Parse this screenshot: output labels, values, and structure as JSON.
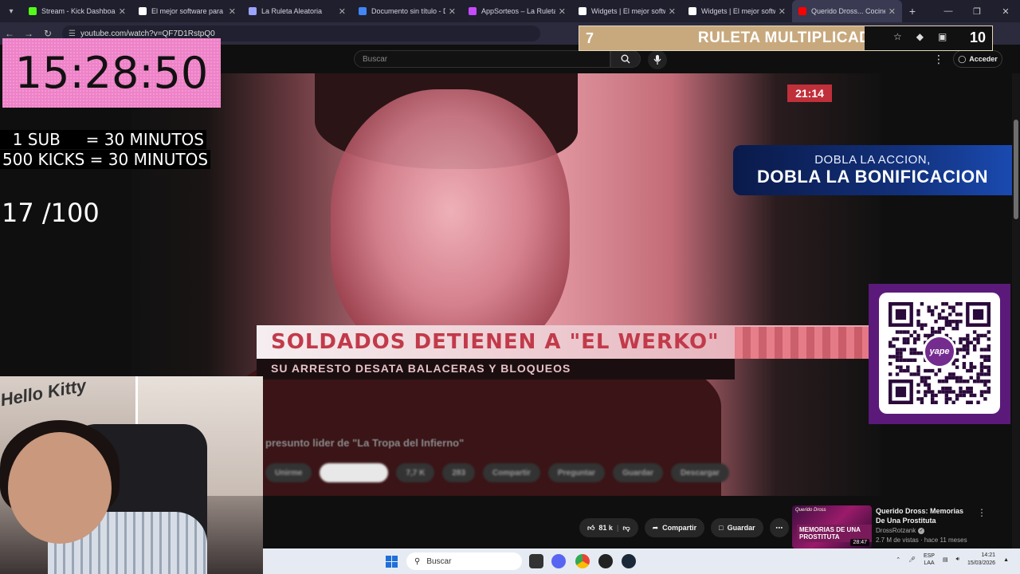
{
  "browser": {
    "tabs": [
      {
        "label": "Stream - Kick Dashboard",
        "color": "#53fc18"
      },
      {
        "label": "El mejor software para pu",
        "color": "#ffffff"
      },
      {
        "label": "La Ruleta Aleatoria",
        "color": "#9aa4ff"
      },
      {
        "label": "Documento sin título - Do",
        "color": "#4285f4"
      },
      {
        "label": "AppSorteos – La Ruleta de",
        "color": "#c64bff"
      },
      {
        "label": "Widgets | El mejor softwa",
        "color": "#ffffff"
      },
      {
        "label": "Widgets | El mejor softwa",
        "color": "#ffffff"
      },
      {
        "label": "Querido Dross... Cociné P",
        "color": "#ff0000",
        "active": true
      }
    ],
    "url": "youtube.com/watch?v=QF7D1RstpQ0"
  },
  "youtube": {
    "search_placeholder": "Buscar",
    "signin_label": "Acceder",
    "actions": {
      "likes": "81 k",
      "share": "Compartir",
      "save": "Guardar"
    },
    "recommendation": {
      "title": "Querido Dross: Memorias De Una Prostituta",
      "channel": "DrossRotzank",
      "meta": "2.7 M de vistas · hace 11 meses",
      "duration": "28:47",
      "thumb_label": "MEMORIAS DE UNA PROSTITUTA",
      "thumb_brand": "Querido Dross"
    }
  },
  "video": {
    "clock": "21:14",
    "headline": "SOLDADOS DETIENEN A \"EL WERKO\"",
    "subheadline": "SU ARRESTO DESATA BALACERAS Y BLOQUEOS",
    "caption": "presunto lider de \"La Tropa del Infierno\"",
    "blurred_actions": [
      "Unirme",
      "7,7 K",
      "283",
      "Compartir",
      "Preguntar",
      "Guardar",
      "Descargar"
    ]
  },
  "overlays": {
    "timer": "15:28:50",
    "rules": [
      "  1 SUB     = 30 MINUTOS",
      "500 KICKS = 30 MINUTOS"
    ],
    "counter": "17 /100",
    "ruleta": {
      "left": "7",
      "title": "RULETA MULTIPLICADORA",
      "right": "10"
    },
    "promo": {
      "line1": "DOBLA LA ACCION,",
      "line2": "DOBLA LA BONIFICACION"
    },
    "qr_brand": "yape",
    "webcam_sign": "Hello Kitty"
  },
  "taskbar": {
    "search_placeholder": "Buscar",
    "lang_line1": "ESP",
    "lang_line2": "LAA",
    "time": "14:21",
    "date": "15/03/2026"
  }
}
